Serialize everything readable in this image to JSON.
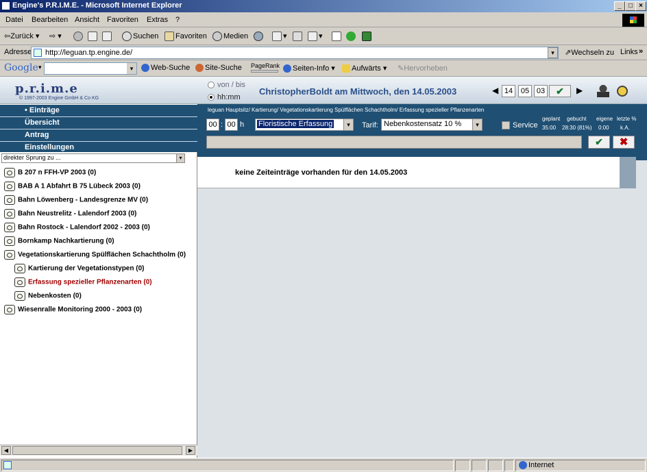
{
  "window": {
    "title": "Engine's P.R.I.M.E. - Microsoft Internet Explorer"
  },
  "menu": [
    "Datei",
    "Bearbeiten",
    "Ansicht",
    "Favoriten",
    "Extras",
    "?"
  ],
  "toolbar": {
    "back": "Zurück",
    "search": "Suchen",
    "favorites": "Favoriten",
    "media": "Medien"
  },
  "address": {
    "label": "Adresse",
    "url": "http://leguan.tp.engine.de/",
    "go": "Wechseln zu",
    "links": "Links"
  },
  "google": {
    "logo": "Google",
    "web_search": "Web-Suche",
    "site_search": "Site-Suche",
    "pagerank": "PageRank",
    "page_info": "Seiten-Info",
    "up": "Aufwärts",
    "highlight": "Hervorheben"
  },
  "app": {
    "logo": "p.r.i.m.e",
    "copyright": "© 1997-2003 Engine GmbH & Co KG",
    "radio_vonbis": "von / bis",
    "radio_hhmm": "hh:mm",
    "title": "ChristopherBoldt am Mittwoch, den 14.05.2003",
    "date": {
      "day": "14",
      "month": "05",
      "year": "03"
    },
    "nav": [
      "• Einträge",
      "Übersicht",
      "Antrag",
      "Einstellungen"
    ],
    "jump_placeholder": "direkter Sprung zu ...",
    "tree": [
      {
        "label": "B 207 n FFH-VP 2003 (0)"
      },
      {
        "label": "BAB A 1 Abfahrt B 75 Lübeck 2003 (0)"
      },
      {
        "label": "Bahn Löwenberg - Landesgrenze MV (0)"
      },
      {
        "label": "Bahn Neustrelitz - Lalendorf 2003 (0)"
      },
      {
        "label": "Bahn Rostock - Lalendorf 2002 - 2003 (0)"
      },
      {
        "label": "Bornkamp Nachkartierung (0)"
      },
      {
        "label": "Vegetationskartierung Spülflächen Schachtholm (0)"
      },
      {
        "label": "Kartierung der Vegetationstypen (0)"
      },
      {
        "label": "Erfassung spezieller Pflanzenarten (0)"
      },
      {
        "label": "Nebenkosten (0)"
      },
      {
        "label": "Wiesenralle Monitoring 2000 - 2003 (0)"
      }
    ],
    "breadcrumb": "leguan Hauptsitz/ Kartierung/ Vegetationskartierung Spülflächen Schachtholm/ Erfassung spezieller Pflanzenarten",
    "hours": "00",
    "minutes": "00",
    "h_label": "h",
    "activity": "Floristische Erfassung",
    "tarif_label": "Tarif:",
    "tarif": "Nebenkostensatz 10 %",
    "service": "Service",
    "stats": {
      "geplant_h": "geplant",
      "geplant": "35:00",
      "gebucht_h": "gebucht",
      "gebucht": "28:30 (81%)",
      "eigene_h": "eigene",
      "eigene": "0:00",
      "letzte_h": "letzte %",
      "letzte": "k.A."
    },
    "message": "keine Zeiteinträge vorhanden für den 14.05.2003"
  },
  "status": {
    "zone": "Internet"
  },
  "colors": {
    "nav": "#1f4f73",
    "selected": "#a00000"
  }
}
